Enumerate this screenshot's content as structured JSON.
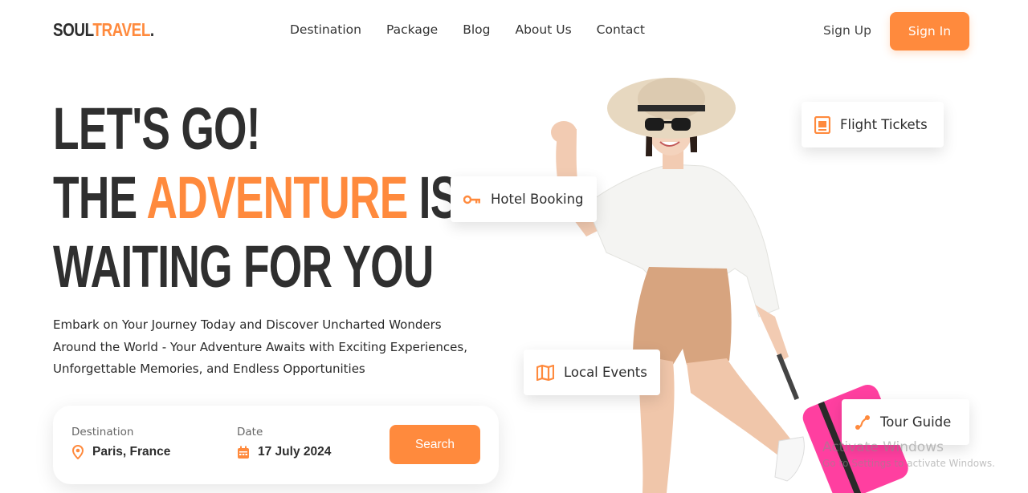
{
  "brand": {
    "part1": "SOUL",
    "part2": "TRAVEL",
    "dot": "."
  },
  "nav": [
    {
      "label": "Destination"
    },
    {
      "label": "Package"
    },
    {
      "label": "Blog"
    },
    {
      "label": "About Us"
    },
    {
      "label": "Contact"
    }
  ],
  "auth": {
    "signup": "Sign Up",
    "signin": "Sign In"
  },
  "hero": {
    "line1": "LET'S GO!",
    "line2_a": "THE ",
    "line2_b": "ADVENTURE",
    "line2_c": " IS",
    "line3": "WAITING FOR YOU"
  },
  "description": {
    "line1": "Embark on Your Journey Today and Discover Uncharted Wonders",
    "line2": "Around the World - Your Adventure Awaits with Exciting Experiences,",
    "line3": "Unforgettable Memories, and Endless Opportunities"
  },
  "search": {
    "destination_label": "Destination",
    "destination_value": "Paris, France",
    "date_label": "Date",
    "date_value": "17 July 2024",
    "button": "Search"
  },
  "badges": {
    "flight": "Flight Tickets",
    "hotel": "Hotel Booking",
    "events": "Local Events",
    "tour": "Tour Guide"
  },
  "watermark": {
    "title": "Activate Windows",
    "sub": "Go to Settings to activate Windows."
  },
  "colors": {
    "accent": "#ff8a3d",
    "dark": "#2f2f2f"
  },
  "icons": {
    "flight": "ticket-icon",
    "hotel": "key-icon",
    "events": "map-icon",
    "tour": "route-icon",
    "destination": "location-pin-icon",
    "date": "calendar-icon"
  }
}
